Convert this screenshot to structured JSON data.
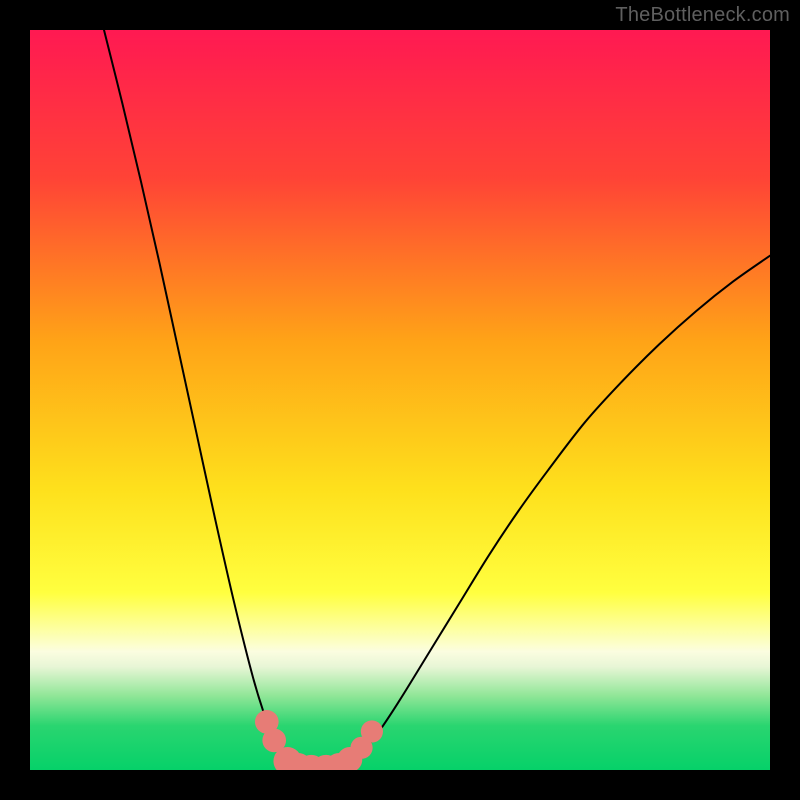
{
  "watermark": "TheBottleneck.com",
  "chart_data": {
    "type": "line",
    "title": "",
    "xlabel": "",
    "ylabel": "",
    "xlim": [
      0,
      100
    ],
    "ylim": [
      0,
      100
    ],
    "gradient_stops": [
      {
        "offset": 0,
        "color": "#ff1952"
      },
      {
        "offset": 20,
        "color": "#ff4336"
      },
      {
        "offset": 42,
        "color": "#ffa317"
      },
      {
        "offset": 62,
        "color": "#fee01c"
      },
      {
        "offset": 76,
        "color": "#ffff3f"
      },
      {
        "offset": 81,
        "color": "#fdffa2"
      },
      {
        "offset": 84,
        "color": "#fbfde0"
      },
      {
        "offset": 86,
        "color": "#e8f6d6"
      },
      {
        "offset": 90,
        "color": "#8fe697"
      },
      {
        "offset": 94,
        "color": "#2ad570"
      },
      {
        "offset": 100,
        "color": "#06d169"
      }
    ],
    "series": [
      {
        "name": "left-curve",
        "x": [
          10.0,
          12.5,
          15.0,
          17.5,
          20.0,
          22.5,
          25.0,
          27.5,
          30.0,
          31.5,
          33.0,
          34.5,
          36.0,
          37.0
        ],
        "values": [
          100.0,
          90.0,
          79.5,
          68.5,
          57.0,
          45.5,
          34.0,
          23.0,
          13.0,
          8.0,
          4.0,
          1.5,
          0.3,
          0.0
        ]
      },
      {
        "name": "right-curve",
        "x": [
          42.0,
          44.0,
          47.0,
          50.0,
          54.0,
          58.0,
          62.0,
          66.0,
          70.0,
          75.0,
          80.0,
          85.0,
          90.0,
          95.0,
          100.0
        ],
        "values": [
          0.0,
          1.5,
          5.0,
          9.5,
          16.0,
          22.5,
          29.0,
          35.0,
          40.5,
          47.0,
          52.5,
          57.5,
          62.0,
          66.0,
          69.5
        ]
      }
    ],
    "markers": {
      "name": "bottom-markers",
      "color": "#e77c76",
      "points": [
        {
          "x": 32.0,
          "y": 6.5,
          "r": 1.6
        },
        {
          "x": 33.0,
          "y": 4.0,
          "r": 1.6
        },
        {
          "x": 34.8,
          "y": 1.2,
          "r": 1.9
        },
        {
          "x": 36.2,
          "y": 0.4,
          "r": 1.9
        },
        {
          "x": 38.0,
          "y": 0.15,
          "r": 1.9
        },
        {
          "x": 40.0,
          "y": 0.15,
          "r": 1.9
        },
        {
          "x": 41.8,
          "y": 0.4,
          "r": 1.9
        },
        {
          "x": 43.2,
          "y": 1.4,
          "r": 1.7
        },
        {
          "x": 44.8,
          "y": 3.0,
          "r": 1.5
        },
        {
          "x": 46.2,
          "y": 5.2,
          "r": 1.5
        }
      ]
    }
  }
}
